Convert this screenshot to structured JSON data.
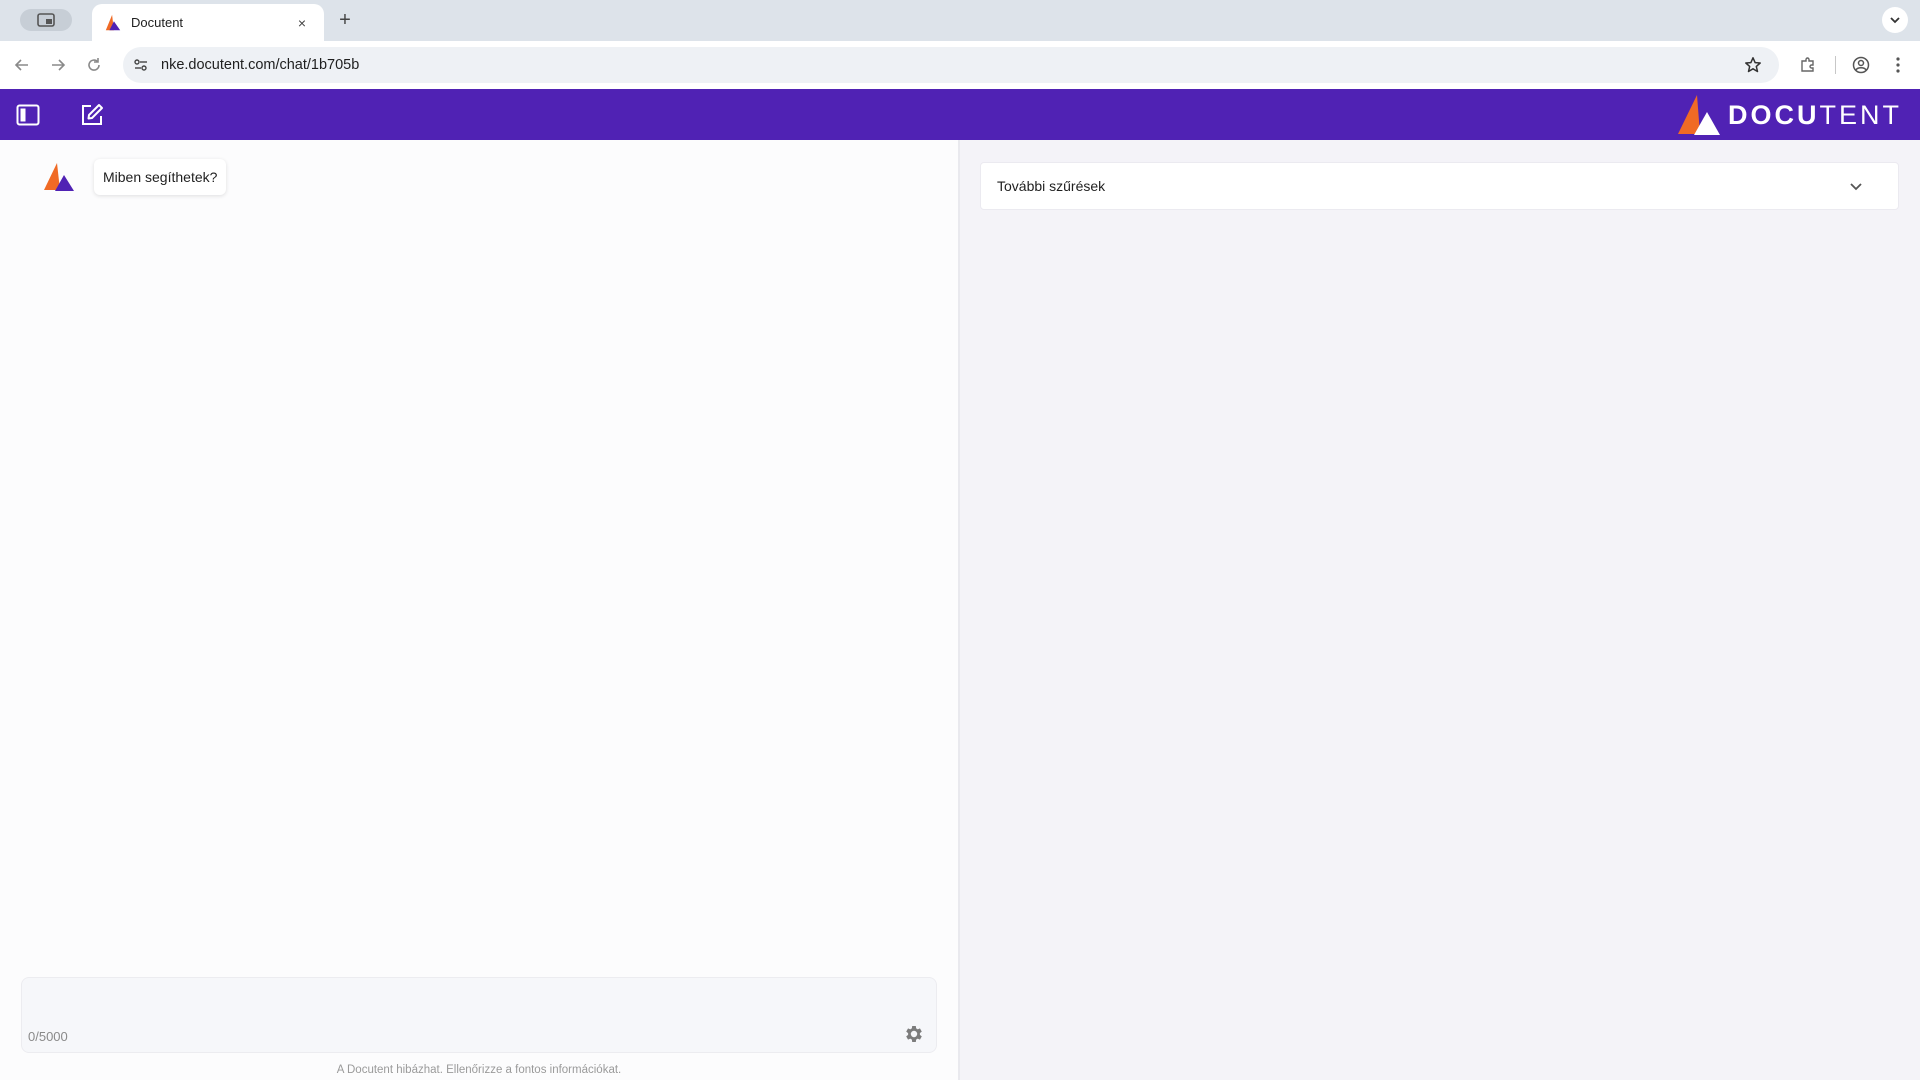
{
  "browser": {
    "tab_title": "Docutent",
    "tab_close": "×",
    "new_tab": "+",
    "url": "nke.docutent.com/chat/1b705b"
  },
  "brand": {
    "name_bold": "DOCU",
    "name_light": "TENT",
    "header_color": "#5022b4",
    "accent_orange": "#f06a25",
    "accent_purple": "#5022b4"
  },
  "chat": {
    "assistant_message": "Miben segíthetek?",
    "input_placeholder": "",
    "char_counter": "0/5000",
    "disclaimer": "A Docutent hibázhat. Ellenőrizze a fontos információkat."
  },
  "filters": {
    "label": "További szűrések"
  },
  "icons": {
    "tab_search": "tab-search-icon",
    "favicon": "docutent-logo-icon",
    "back": "arrow-left-icon",
    "forward": "arrow-right-icon",
    "reload": "reload-icon",
    "site_info": "tune-icon",
    "bookmark": "star-icon",
    "extensions": "puzzle-icon",
    "profile": "account-icon",
    "menu": "kebab-menu-icon",
    "sidebar_toggle": "sidebar-icon",
    "new_chat": "edit-icon",
    "settings": "gear-icon",
    "expand": "chevron-down-icon"
  }
}
